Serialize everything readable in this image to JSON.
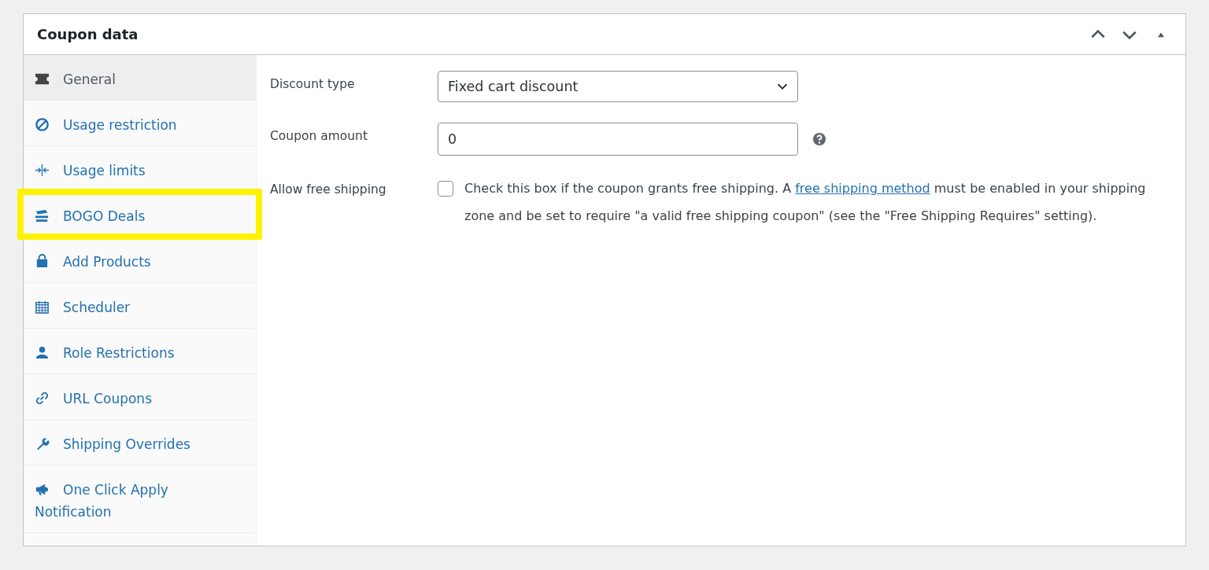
{
  "panel": {
    "title": "Coupon data"
  },
  "header_controls": [
    {
      "kind": "up"
    },
    {
      "kind": "down"
    },
    {
      "kind": "toggle"
    }
  ],
  "tabs": [
    {
      "label": "General",
      "selected": true,
      "highlighted": false
    },
    {
      "label": "Usage restriction",
      "selected": false,
      "highlighted": false
    },
    {
      "label": "Usage limits",
      "selected": false,
      "highlighted": false
    },
    {
      "label": "BOGO Deals",
      "selected": false,
      "highlighted": true
    },
    {
      "label": "Add Products",
      "selected": false,
      "highlighted": false
    },
    {
      "label": "Scheduler",
      "selected": false,
      "highlighted": false
    },
    {
      "label": "Role Restrictions",
      "selected": false,
      "highlighted": false
    },
    {
      "label": "URL Coupons",
      "selected": false,
      "highlighted": false
    },
    {
      "label": "Shipping Overrides",
      "selected": false,
      "highlighted": false
    },
    {
      "label": "One Click Apply Notification",
      "selected": false,
      "highlighted": false
    }
  ],
  "fields": [
    {
      "kind": "select",
      "label": "Discount type",
      "value": "Fixed cart discount"
    },
    {
      "kind": "text",
      "label": "Coupon amount",
      "value": "0",
      "help": true
    },
    {
      "kind": "checkbox",
      "label": "Allow free shipping",
      "checked": false,
      "description_before": "Check this box if the coupon grants free shipping. A ",
      "link": "free shipping method",
      "description_after": " must be enabled in your shipping zone and be set to require \"a valid free shipping coupon\" (see the \"Free Shipping Requires\" setting)."
    }
  ]
}
